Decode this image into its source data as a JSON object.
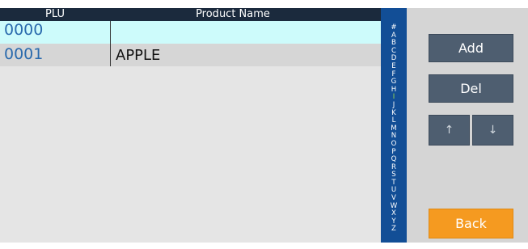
{
  "table": {
    "headers": {
      "plu": "PLU",
      "name": "Product Name"
    },
    "rows": [
      {
        "plu": "0000",
        "name": ""
      },
      {
        "plu": "0001",
        "name": "APPLE"
      }
    ]
  },
  "alphabet": [
    "#",
    "A",
    "B",
    "C",
    "D",
    "E",
    "F",
    "G",
    "H",
    "I",
    "J",
    "K",
    "L",
    "M",
    "N",
    "O",
    "P",
    "Q",
    "R",
    "S",
    "T",
    "U",
    "V",
    "W",
    "X",
    "Y",
    "Z"
  ],
  "alphabet_highlight": "I",
  "buttons": {
    "add": "Add",
    "del": "Del",
    "up": "↑",
    "down": "↓",
    "back": "Back"
  },
  "colors": {
    "header_bg": "#1b2a3d",
    "selected_row": "#cdfbfb",
    "alpha_strip": "#124e96",
    "button": "#4e5e70",
    "back_button": "#f59a20"
  }
}
